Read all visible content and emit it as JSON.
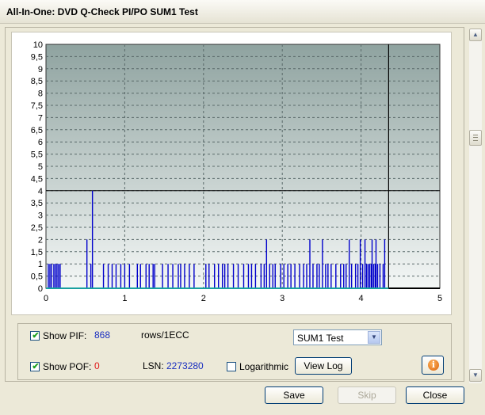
{
  "window": {
    "title": "All-In-One: DVD Q-Check PI/PO SUM1 Test"
  },
  "options": {
    "show_pif_label": "Show PIF:",
    "show_pif_checked": true,
    "pif_value": "868",
    "pif_unit": "rows/1ECC",
    "show_pof_label": "Show POF:",
    "show_pof_checked": true,
    "pof_value": "0",
    "lsn_label": "LSN:",
    "lsn_value": "2273280",
    "logarithmic_label": "Logarithmic",
    "logarithmic_checked": false,
    "test_select_value": "SUM1 Test",
    "view_log_label": "View Log",
    "info_icon": "info-icon"
  },
  "buttons": {
    "save": "Save",
    "skip": "Skip",
    "close": "Close"
  },
  "scrollbar": {
    "up_icon": "arrow-up-icon",
    "down_icon": "arrow-down-icon"
  },
  "colors": {
    "pif_bars": "#0000cc",
    "threshold": "#000000",
    "grid": "#5a6a6a",
    "plot_bg_top": "#8fa3a0",
    "plot_bg_bottom": "#f4f7f6"
  },
  "chart_data": {
    "type": "bar",
    "title": "",
    "xlabel": "",
    "ylabel": "",
    "xlim": [
      0,
      5
    ],
    "ylim": [
      0,
      10
    ],
    "x_ticks": [
      "0",
      "1",
      "2",
      "3",
      "4",
      "5"
    ],
    "y_ticks": [
      "0",
      "0,5",
      "1",
      "1,5",
      "2",
      "2,5",
      "3",
      "3,5",
      "4",
      "4,5",
      "5",
      "5,5",
      "6",
      "6,5",
      "7",
      "7,5",
      "8",
      "8,5",
      "9",
      "9,5",
      "10"
    ],
    "grid": true,
    "threshold_y": 4,
    "scan_end_x": 4.35,
    "series": [
      {
        "name": "PIF",
        "x": [
          0.03,
          0.05,
          0.07,
          0.1,
          0.12,
          0.14,
          0.16,
          0.18,
          0.52,
          0.57,
          0.59,
          0.73,
          0.79,
          0.84,
          0.89,
          0.95,
          1.0,
          1.06,
          1.16,
          1.2,
          1.27,
          1.31,
          1.36,
          1.38,
          1.48,
          1.55,
          1.61,
          1.68,
          1.71,
          1.76,
          1.82,
          1.88,
          2.03,
          2.07,
          2.14,
          2.19,
          2.24,
          2.27,
          2.31,
          2.38,
          2.44,
          2.51,
          2.57,
          2.61,
          2.66,
          2.73,
          2.77,
          2.8,
          2.84,
          2.88,
          2.91,
          2.98,
          3.02,
          3.07,
          3.11,
          3.16,
          3.22,
          3.27,
          3.31,
          3.35,
          3.39,
          3.44,
          3.47,
          3.51,
          3.55,
          3.58,
          3.62,
          3.68,
          3.74,
          3.78,
          3.81,
          3.85,
          3.88,
          3.93,
          3.96,
          3.99,
          4.02,
          4.05,
          4.07,
          4.09,
          4.11,
          4.13,
          4.14,
          4.16,
          4.18,
          4.19,
          4.21,
          4.24,
          4.28,
          4.3
        ],
        "values": [
          1,
          1,
          1,
          1,
          1,
          1,
          1,
          1,
          2,
          1,
          4,
          1,
          1,
          1,
          1,
          1,
          1,
          1,
          1,
          1,
          1,
          1,
          1,
          1,
          1,
          1,
          1,
          1,
          1,
          1,
          1,
          1,
          1,
          1,
          1,
          1,
          1,
          1,
          1,
          1,
          1,
          1,
          1,
          1,
          1,
          1,
          1,
          2,
          1,
          1,
          1,
          1,
          1,
          1,
          1,
          1,
          1,
          1,
          1,
          2,
          1,
          1,
          1,
          2,
          1,
          1,
          1,
          1,
          1,
          1,
          1,
          2,
          1,
          1,
          1,
          2,
          1,
          2,
          1,
          1,
          1,
          1,
          2,
          1,
          1,
          2,
          1,
          1,
          1,
          2
        ]
      }
    ]
  }
}
